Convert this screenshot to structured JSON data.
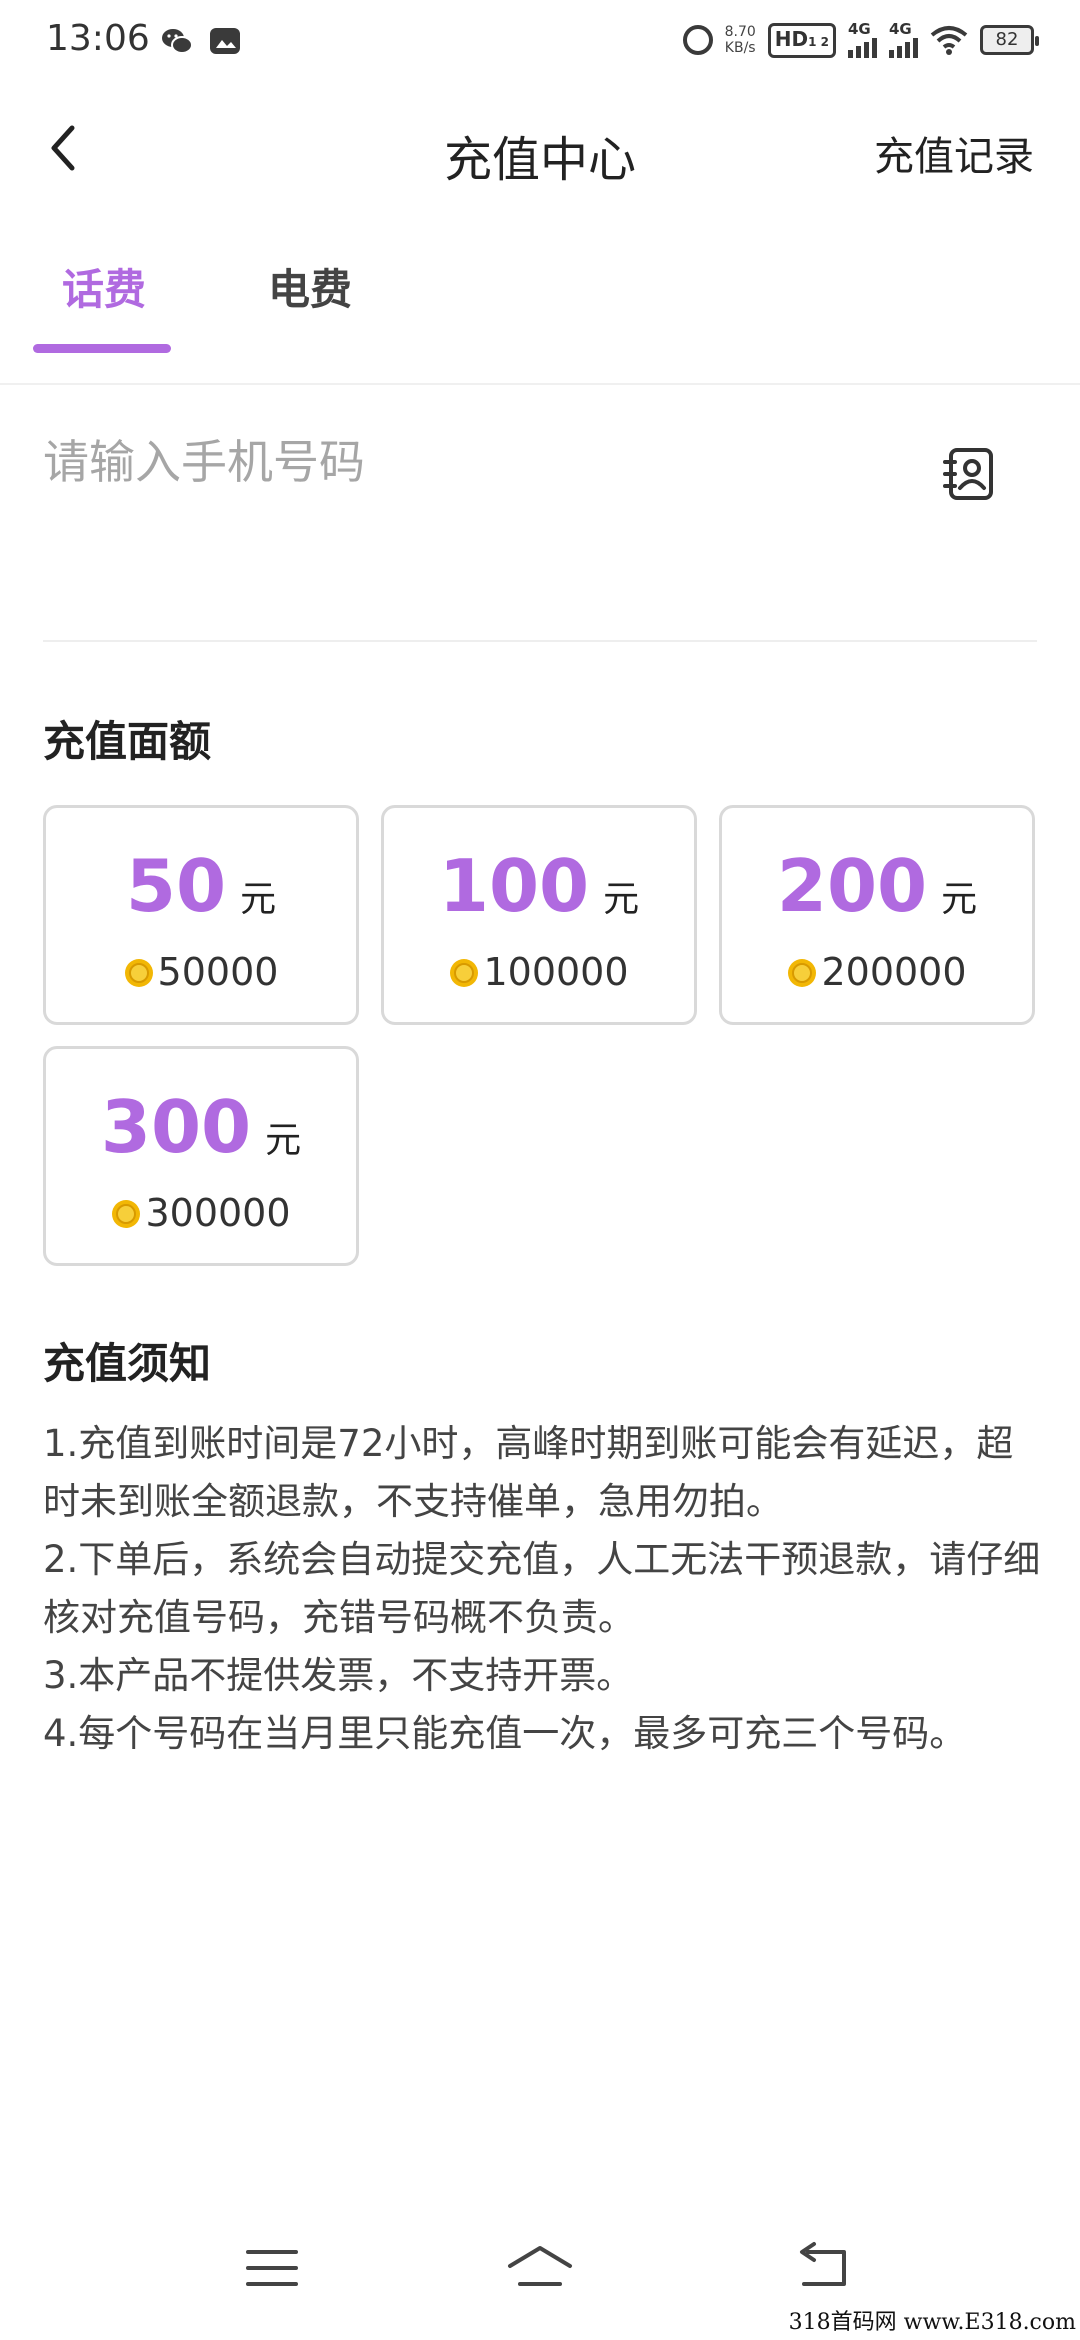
{
  "status_bar": {
    "time": "13:06",
    "app_icons": [
      "wechat-icon",
      "gallery-icon"
    ],
    "net_speed_value": "8.70",
    "net_speed_unit": "KB/s",
    "hd_label": "HD",
    "hd_sub": "1 2",
    "network_1": "4G",
    "network_2": "4G",
    "battery": "82"
  },
  "header": {
    "title": "充值中心",
    "record_link": "充值记录",
    "back_icon": "chevron-left-icon"
  },
  "tabs": [
    {
      "label": "话费",
      "active": true
    },
    {
      "label": "电费",
      "active": false
    }
  ],
  "phone": {
    "placeholder": "请输入手机号码",
    "value": "",
    "contact_icon": "address-book-icon"
  },
  "amount_section": {
    "title": "充值面额",
    "items": [
      {
        "value": "50",
        "unit": "元",
        "coins": "50000"
      },
      {
        "value": "100",
        "unit": "元",
        "coins": "100000"
      },
      {
        "value": "200",
        "unit": "元",
        "coins": "200000"
      },
      {
        "value": "300",
        "unit": "元",
        "coins": "300000"
      }
    ]
  },
  "notice": {
    "title": "充值须知",
    "lines": [
      "1.充值到账时间是72小时，高峰时期到账可能会有延迟，超时未到账全额退款，不支持催单，急用勿拍。",
      "2.下单后，系统会自动提交充值，人工无法干预退款，请仔细核对充值号码，充错号码概不负责。",
      "3.本产品不提供发票，不支持开票。",
      "4.每个号码在当月里只能充值一次，最多可充三个号码。"
    ]
  },
  "nav_bar": {
    "icons": [
      "menu-icon",
      "home-icon",
      "back-icon"
    ]
  },
  "watermark": "318首码网 www.E318.com",
  "colors": {
    "accent": "#b06ae0",
    "coin": "#f2b705",
    "border": "#d9d9d9"
  }
}
